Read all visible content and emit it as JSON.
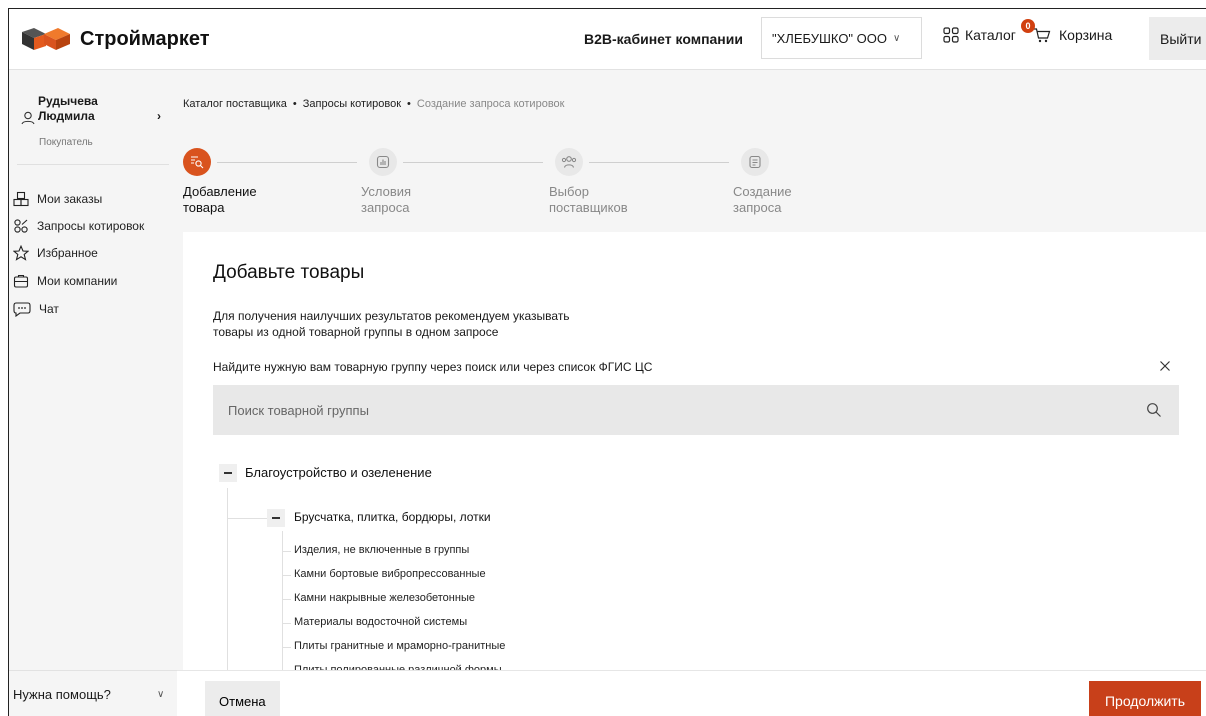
{
  "header": {
    "logo_text": "Строймаркет",
    "b2b_label": "B2B-кабинет компании",
    "company_selected": "\"ХЛЕБУШКО\" ООО",
    "catalog_label": "Каталог",
    "cart_label": "Корзина",
    "cart_count": "0",
    "logout_label": "Выйти"
  },
  "sidebar": {
    "user_first": "Рудычева",
    "user_last": "Людмила",
    "user_role": "Покупатель",
    "items": [
      {
        "label": "Мои заказы",
        "icon": "orders-icon"
      },
      {
        "label": "Запросы котировок",
        "icon": "quotes-icon"
      },
      {
        "label": "Избранное",
        "icon": "star-icon"
      },
      {
        "label": "Мои компании",
        "icon": "briefcase-icon"
      },
      {
        "label": "Чат",
        "icon": "chat-icon"
      }
    ],
    "help_label": "Нужна помощь?"
  },
  "breadcrumbs": [
    "Каталог поставщика",
    "Запросы котировок",
    "Создание запроса котировок"
  ],
  "steps": [
    {
      "line1": "Добавление",
      "line2": "товара",
      "active": true
    },
    {
      "line1": "Условия",
      "line2": "запроса",
      "active": false
    },
    {
      "line1": "Выбор",
      "line2": "поставщиков",
      "active": false
    },
    {
      "line1": "Создание",
      "line2": "запроса",
      "active": false
    }
  ],
  "panel": {
    "title": "Добавьте товары",
    "hint_line1": "Для получения наилучших результатов рекомендуем указывать",
    "hint_line2": "товары из одной товарной группы в одном запросе",
    "find_text": "Найдите нужную вам товарную группу через поиск или через список ФГИС ЦС",
    "search_placeholder": "Поиск товарной группы"
  },
  "tree": {
    "root": "Благоустройство и озеленение",
    "group": "Брусчатка, плитка, бордюры, лотки",
    "leaves": [
      "Изделия, не включенные в группы",
      "Камни бортовые вибропрессованные",
      "Камни накрывные железобетонные",
      "Материалы водосточной системы",
      "Плиты гранитные и мраморно-гранитные",
      "Плиты полированные различной формы"
    ]
  },
  "footer": {
    "cancel_label": "Отмена",
    "continue_label": "Продолжить"
  },
  "colors": {
    "accent": "#d9531e",
    "button_primary": "#c8401a",
    "sidebar_bg": "#f5f5f5"
  }
}
